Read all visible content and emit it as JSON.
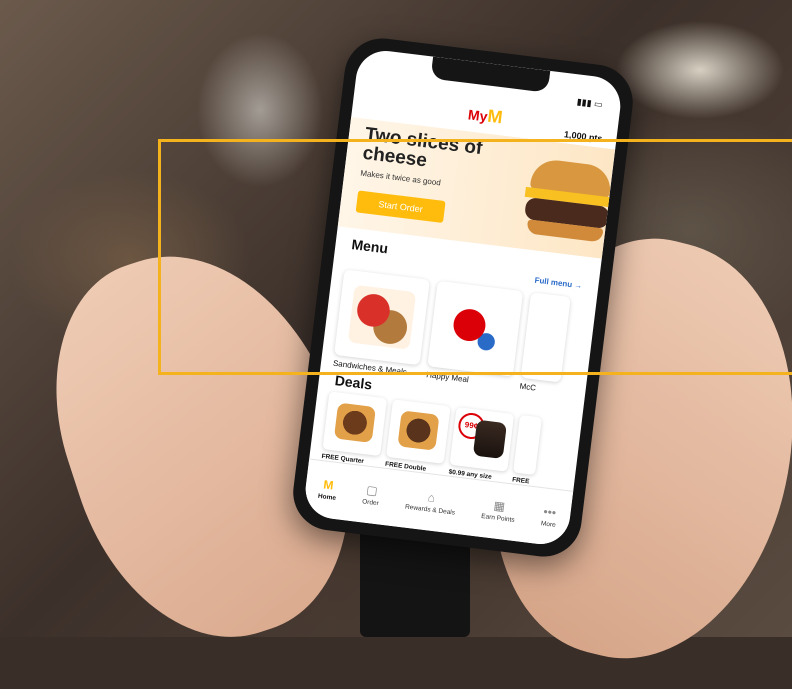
{
  "header": {
    "logo_text": "My",
    "points": "1,000 pts"
  },
  "hero": {
    "title": "Two slices of cheese",
    "subtitle": "Makes it twice as good",
    "cta_label": "Start Order"
  },
  "menu": {
    "title": "Menu",
    "full_menu_link": "Full menu →",
    "items": [
      {
        "label": "Sandwiches & Meals"
      },
      {
        "label": "Happy Meal"
      },
      {
        "label": "McC"
      }
    ]
  },
  "deals": {
    "title": "Deals",
    "items": [
      {
        "label": "FREE Quarter"
      },
      {
        "label": "FREE Double"
      },
      {
        "label": "$0.99 any size",
        "badge": "99¢"
      },
      {
        "label": "FREE"
      }
    ]
  },
  "tabbar": {
    "items": [
      {
        "label": "Home",
        "icon": "arches-icon"
      },
      {
        "label": "Order",
        "icon": "bag-icon"
      },
      {
        "label": "Rewards & Deals",
        "icon": "rewards-icon"
      },
      {
        "label": "Earn Points",
        "icon": "qr-code-icon"
      },
      {
        "label": "More",
        "icon": "more-icon"
      }
    ]
  },
  "colors": {
    "brand_yellow": "#ffbc0d",
    "brand_red": "#db0007",
    "link_blue": "#2b6bc8",
    "highlight_frame": "#f4b31c"
  }
}
